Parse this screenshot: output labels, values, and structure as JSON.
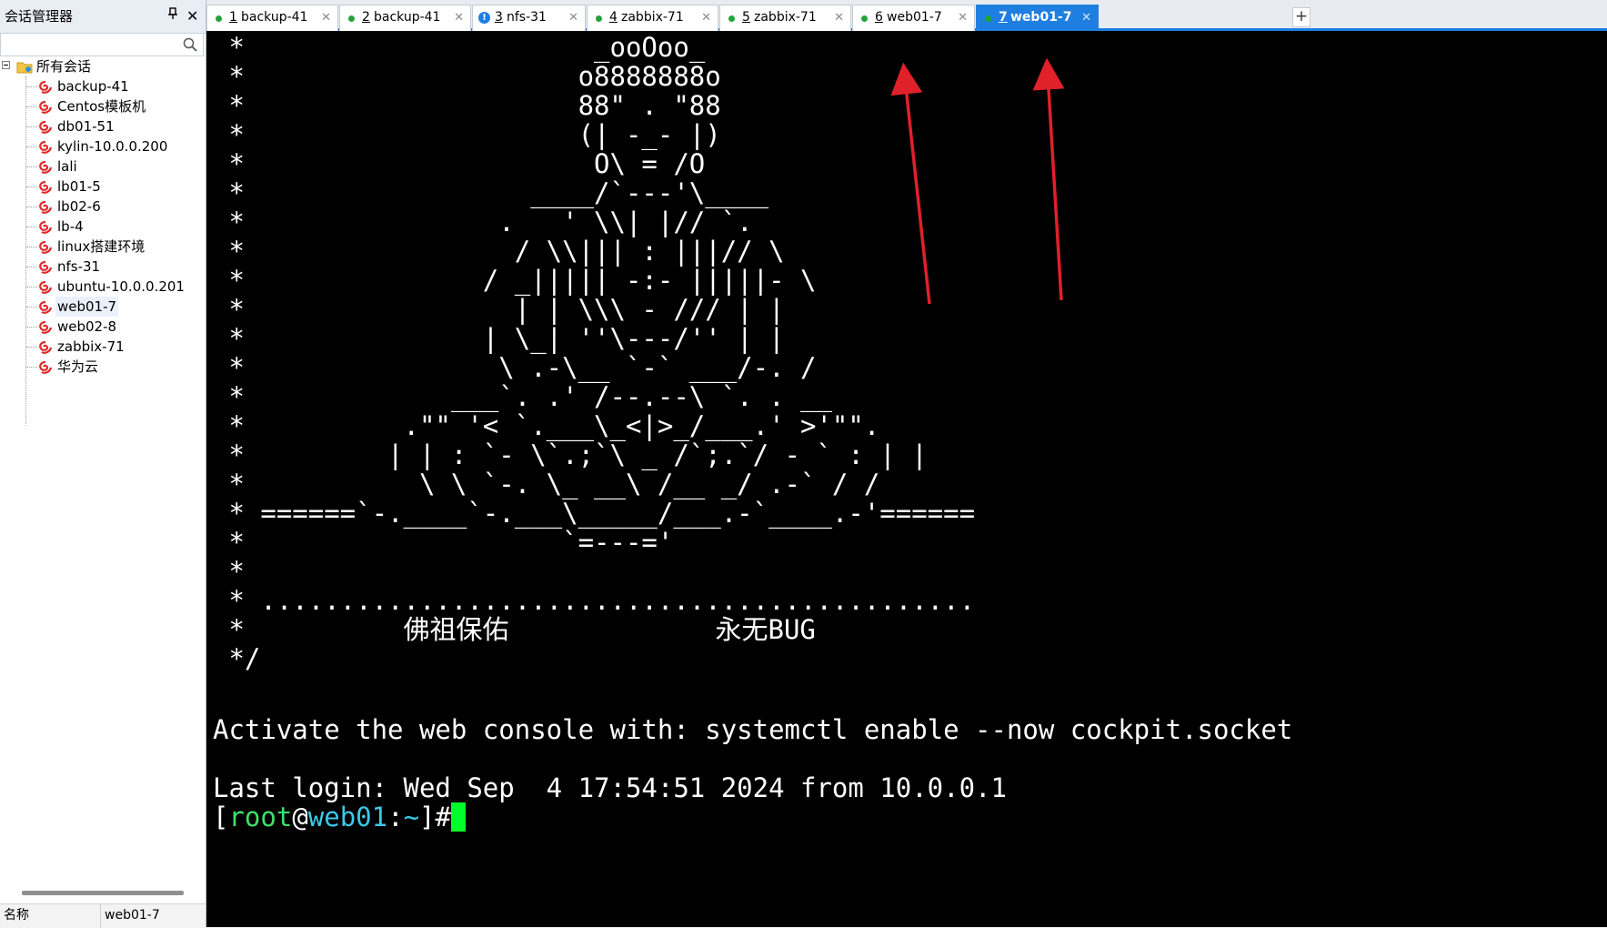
{
  "sidebar": {
    "title": "会话管理器",
    "pin_glyph": "📌",
    "close_glyph": "✕",
    "search_placeholder": "",
    "root_label": "所有会话",
    "items": [
      {
        "label": "backup-41"
      },
      {
        "label": "Centos模板机"
      },
      {
        "label": "db01-51"
      },
      {
        "label": "kylin-10.0.0.200"
      },
      {
        "label": "lali"
      },
      {
        "label": "lb01-5"
      },
      {
        "label": "lb02-6"
      },
      {
        "label": "lb-4"
      },
      {
        "label": "linux搭建环境"
      },
      {
        "label": "nfs-31"
      },
      {
        "label": "ubuntu-10.0.0.201"
      },
      {
        "label": "web01-7",
        "selected": true
      },
      {
        "label": "web02-8"
      },
      {
        "label": "zabbix-71"
      },
      {
        "label": "华为云"
      }
    ],
    "footer": {
      "name_label": "名称",
      "value": "web01-7"
    }
  },
  "tabs": [
    {
      "num": "1",
      "name": "backup-41",
      "status": "connected"
    },
    {
      "num": "2",
      "name": "backup-41",
      "status": "connected"
    },
    {
      "num": "3",
      "name": "nfs-31",
      "status": "info"
    },
    {
      "num": "4",
      "name": "zabbix-71",
      "status": "connected"
    },
    {
      "num": "5",
      "name": "zabbix-71",
      "status": "connected"
    },
    {
      "num": "6",
      "name": "web01-7",
      "status": "connected"
    },
    {
      "num": "7",
      "name": "web01-7",
      "status": "connected",
      "active": true
    }
  ],
  "tab_close_glyph": "✕",
  "tab_add_glyph": "+",
  "terminal": {
    "art_lines": [
      " *                      _ooOoo_",
      " *                     o8888888o",
      " *                     88\" . \"88",
      " *                     (| -_- |)",
      " *                      O\\ = /O",
      " *                  ____/`---'\\____",
      " *                .   ' \\\\| |// `.",
      " *                 / \\\\||| : |||// \\",
      " *               / _||||| -:- |||||- \\",
      " *                 | | \\\\\\ - /// | |",
      " *               | \\_| ''\\---/'' | |",
      " *                \\ .-\\__ `-` ___/-. /",
      " *             ___`. .' /--.--\\ `. . __",
      " *          .\"\" '< `.___\\_<|>_/___.' >'\"\".",
      " *         | | : `- \\`.;`\\ _ /`;.`/ - ` : | |",
      " *           \\ \\ `-. \\_ __\\ /__ _/ .-` / /",
      " * ======`-.____`-.___\\_____/___.-`____.-'======",
      " *                    `=---='",
      " *",
      " * .............................................",
      " *          佛祖保佑             永无BUG",
      " */"
    ],
    "cockpit_line": "Activate the web console with: systemctl enable --now cockpit.socket",
    "last_login": "Last login: Wed Sep  4 17:54:51 2024 from 10.0.0.1",
    "prompt": {
      "open": "[",
      "user": "root",
      "at": "@",
      "host": "web01",
      "colon": ":",
      "path": "~",
      "close": "]#"
    }
  },
  "colors": {
    "accent_blue": "#1e7fe0",
    "connected_green": "#22a33a",
    "annotation_red": "#e0202a",
    "terminal_bg": "#000000",
    "cursor_green": "#00ff2a"
  },
  "icons": {
    "search": "search-icon",
    "folder": "folder-icon",
    "session": "session-swirl-icon",
    "pin": "pin-icon",
    "close": "close-icon"
  }
}
